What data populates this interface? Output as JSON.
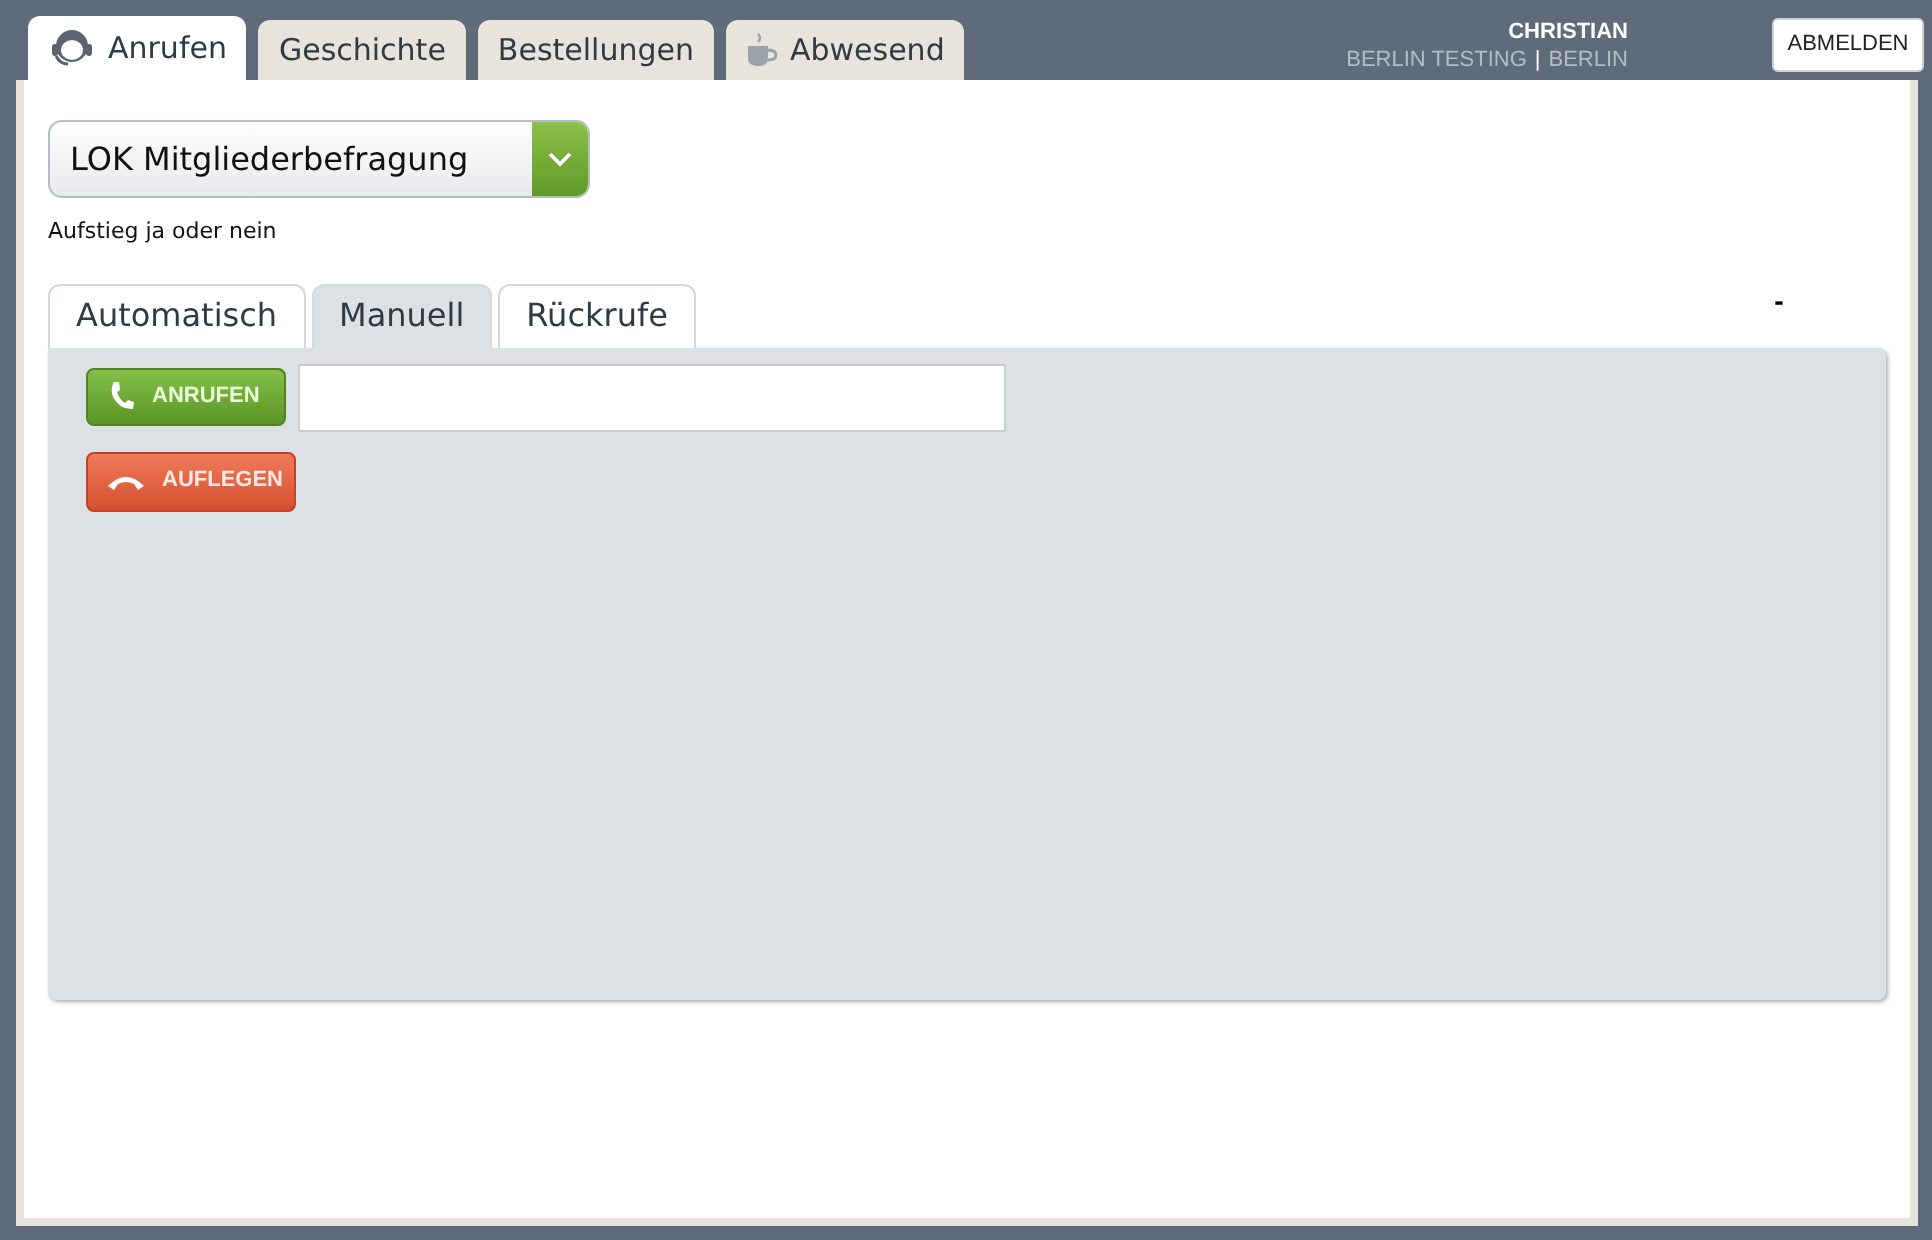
{
  "main_tabs": [
    {
      "label": "Anrufen",
      "kind": "agent",
      "selected": true
    },
    {
      "label": "Geschichte",
      "selected": false
    },
    {
      "label": "Bestellungen",
      "selected": false
    },
    {
      "label": "Abwesend",
      "kind": "cup",
      "selected": false
    }
  ],
  "user": {
    "name": "CHRISTIAN",
    "team": "BERLIN TESTING",
    "separator": "|",
    "location": "BERLIN"
  },
  "logout_button": "ABMELDEN",
  "campaign_select": {
    "value": "LOK Mitgliederbefragung"
  },
  "campaign_description": "Aufstieg ja oder nein",
  "sub_tabs": [
    {
      "label": "Automatisch",
      "selected": false
    },
    {
      "label": "Manuell",
      "selected": true
    },
    {
      "label": "Rückrufe",
      "selected": false
    }
  ],
  "corner_mark": "-",
  "call_button": "ANRUFEN",
  "hangup_button": "AUFLEGEN"
}
